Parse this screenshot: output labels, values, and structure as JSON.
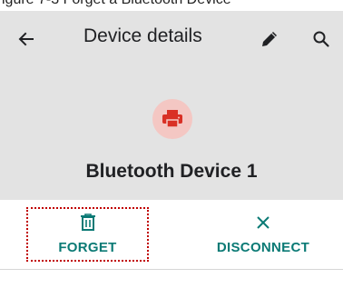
{
  "partial_top_text": "igure 7-3 Forget a Bluetooth Device",
  "toolbar": {
    "title": "Device details",
    "back_icon": "arrow-left",
    "edit_icon": "pencil",
    "search_icon": "magnifier"
  },
  "device": {
    "name": "Bluetooth Device 1",
    "icon": "printer",
    "icon_color": "#d93025",
    "icon_bg": "#f4c7c3"
  },
  "actions": [
    {
      "label": "FORGET",
      "icon": "trash"
    },
    {
      "label": "DISCONNECT",
      "icon": "close-x"
    }
  ],
  "colors": {
    "accent": "#0b7a75",
    "header_bg": "#e3e3e3",
    "highlight": "#c00000"
  }
}
